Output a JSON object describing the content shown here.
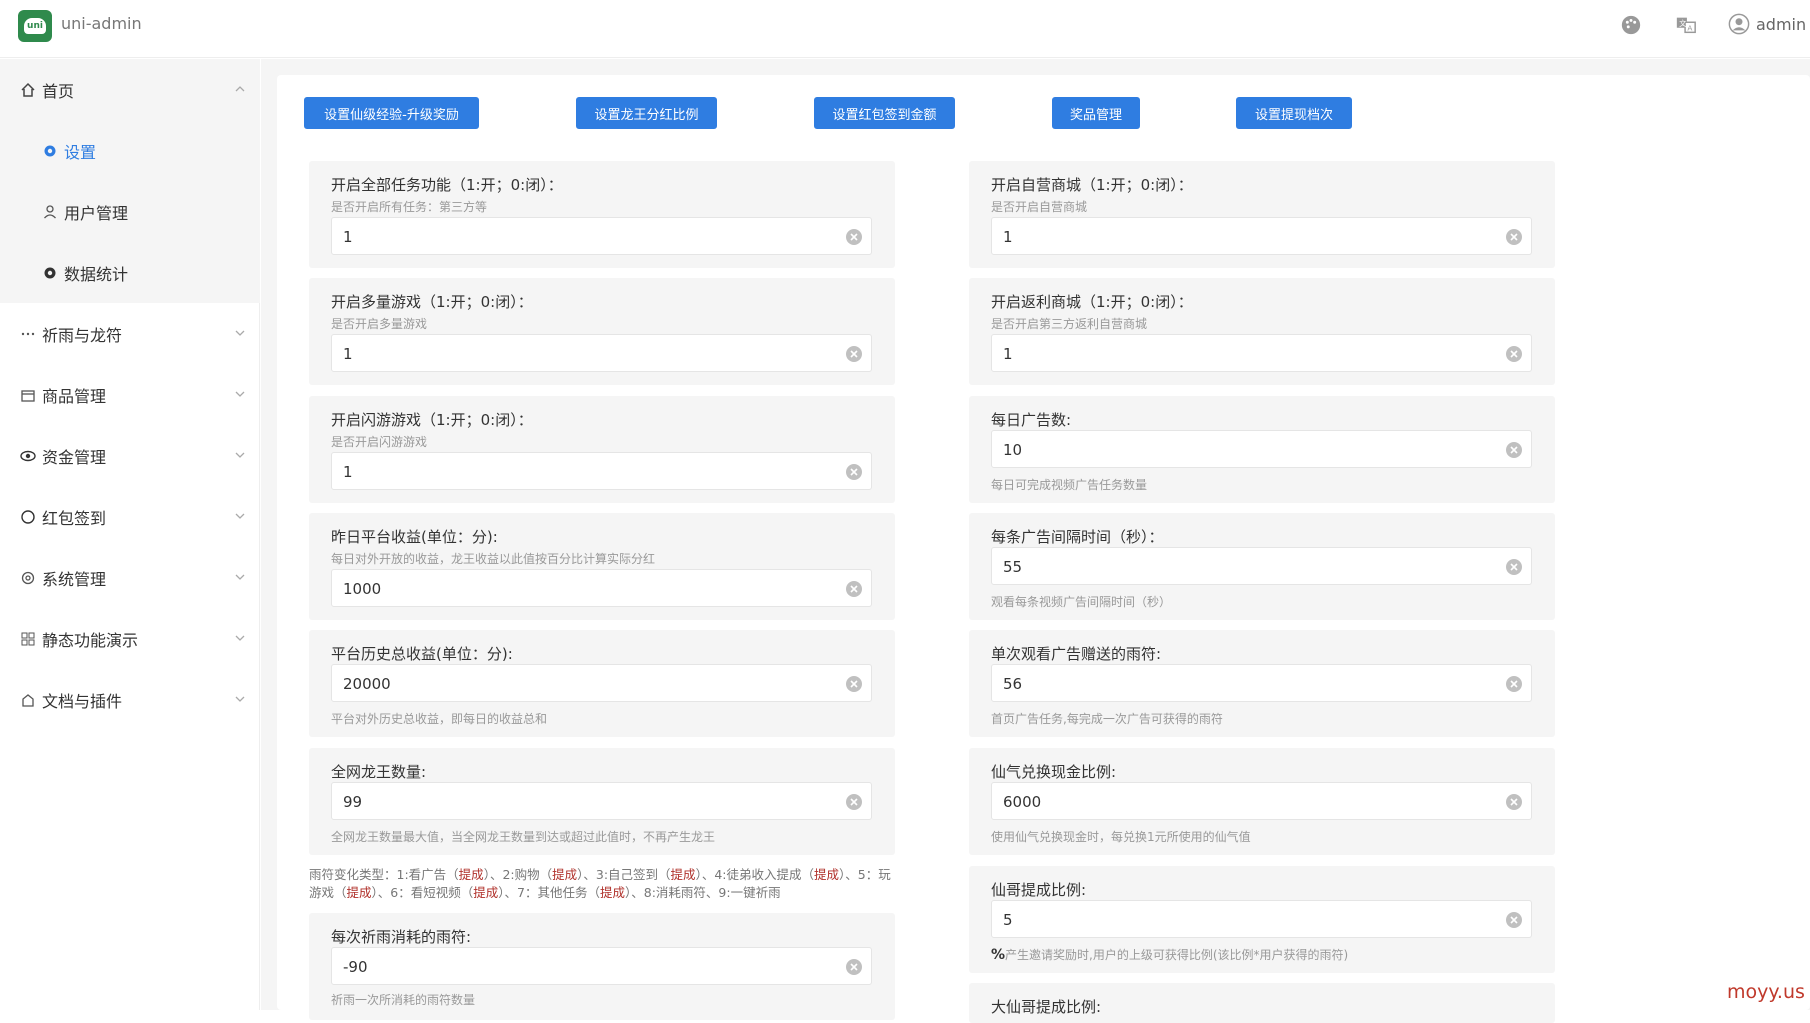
{
  "header": {
    "logo_text": "uni",
    "app_title": "uni-admin",
    "user": "admin",
    "icons": [
      "palette-icon",
      "translate-icon",
      "user-icon",
      "chevron-down-icon"
    ]
  },
  "sidebar": {
    "items": [
      {
        "label": "首页",
        "icon": "home-icon"
      },
      {
        "label": "设置",
        "icon": "gear-icon"
      },
      {
        "label": "用户管理",
        "icon": "user-icon"
      },
      {
        "label": "数据统计",
        "icon": "gear-icon"
      },
      {
        "label": "祈雨与龙符",
        "icon": "more-icon"
      },
      {
        "label": "商品管理",
        "icon": "shop-icon"
      },
      {
        "label": "资金管理",
        "icon": "eye-icon"
      },
      {
        "label": "红包签到",
        "icon": "circle-icon"
      },
      {
        "label": "系统管理",
        "icon": "settings-icon"
      },
      {
        "label": "静态功能演示",
        "icon": "grid-icon"
      },
      {
        "label": "文档与插件",
        "icon": "plugin-icon"
      }
    ]
  },
  "toolbar": {
    "buttons": [
      "设置仙级经验-升级奖励",
      "设置龙王分红比例",
      "设置红包签到金额",
      "奖品管理",
      "设置提现档次"
    ]
  },
  "left_fields": [
    {
      "label": "开启全部任务功能（1:开；0:闭）：",
      "desc": "是否开启所有任务：第三方等",
      "value": "1"
    },
    {
      "label": "开启多量游戏（1:开；0:闭）：",
      "desc": "是否开启多量游戏",
      "value": "1"
    },
    {
      "label": "开启闪游游戏（1:开；0:闭）：",
      "desc": "是否开启闪游游戏",
      "value": "1"
    },
    {
      "label": "昨日平台收益(单位：分):",
      "desc": "每日对外开放的收益，龙王收益以此值按百分比计算实际分红",
      "value": "1000"
    },
    {
      "label": "平台历史总收益(单位：分):",
      "desc": "平台对外历史总收益，即每日的收益总和",
      "value": "20000"
    },
    {
      "label": "全网龙王数量:",
      "desc": "全网龙王数量最大值，当全网龙王数量到达或超过此值时，不再产生龙王",
      "value": "99"
    },
    {
      "label": "每次祈雨消耗的雨符:",
      "desc": "祈雨一次所消耗的雨符数量",
      "value": "-90"
    }
  ],
  "right_fields": [
    {
      "label": "开启自营商城（1:开；0:闭）：",
      "desc": "是否开启自营商城",
      "value": "1"
    },
    {
      "label": "开启返利商城（1:开；0:闭）：",
      "desc": "是否开启第三方返利自营商城",
      "value": "1"
    },
    {
      "label": "每日广告数:",
      "desc": "每日可完成视频广告任务数量",
      "value": "10"
    },
    {
      "label": "每条广告间隔时间（秒）：",
      "desc": "观看每条视频广告间隔时间（秒）",
      "value": "55"
    },
    {
      "label": "单次观看广告赠送的雨符:",
      "desc": "首页广告任务,每完成一次广告可获得的雨符",
      "value": "56"
    },
    {
      "label": "仙气兑换现金比例:",
      "desc": "使用仙气兑换现金时，每兑换1元所使用的仙气值",
      "value": "6000"
    },
    {
      "label": "仙哥提成比例:",
      "desc_prefix": "%",
      "desc": "产生邀请奖励时,用户的上级可获得比例(该比例*用户获得的雨符)",
      "value": "5"
    },
    {
      "label": "大仙哥提成比例:"
    }
  ],
  "note": {
    "p1": "雨符变化类型：1:看广告（",
    "t1": "提成",
    "p2": "）、2:购物（",
    "t2": "提成",
    "p3": "）、3:自己签到（",
    "t3": "提成",
    "p4": "）、4:徒弟收入提成（",
    "t4": "提成",
    "p5": "）、5：玩游戏（",
    "t5": "提成",
    "p6": "）、6：看短视频（",
    "t6": "提成",
    "p7": "）、7：其他任务（",
    "t7": "提成",
    "p8": "）、8:消耗雨符、9:一键祈雨"
  },
  "watermark": "moyy.us"
}
